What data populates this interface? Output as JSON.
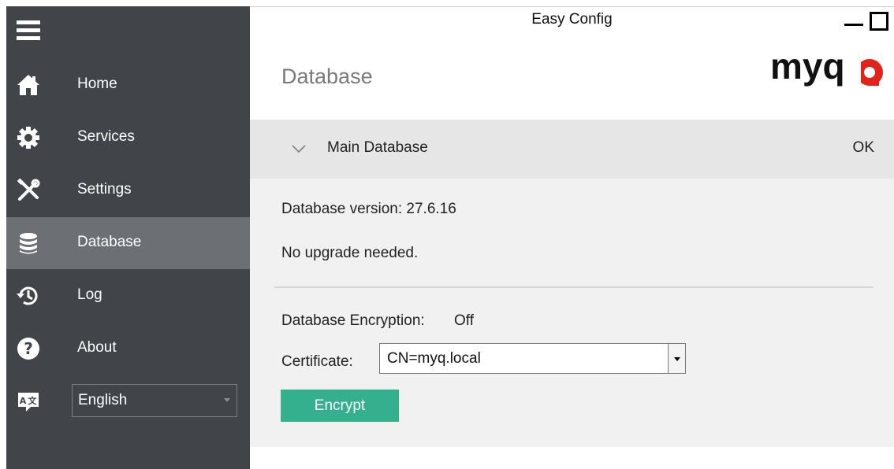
{
  "window": {
    "title": "Easy Config"
  },
  "sidebar": {
    "items": [
      {
        "label": "Home",
        "icon": "home-icon"
      },
      {
        "label": "Services",
        "icon": "gear-icon"
      },
      {
        "label": "Settings",
        "icon": "tools-icon"
      },
      {
        "label": "Database",
        "icon": "database-icon",
        "active": true
      },
      {
        "label": "Log",
        "icon": "history-icon"
      },
      {
        "label": "About",
        "icon": "help-icon"
      }
    ],
    "language": {
      "value": "English",
      "icon": "language-icon"
    }
  },
  "page": {
    "title": "Database",
    "logo_text": "myq"
  },
  "panel": {
    "title": "Main Database",
    "status": "OK",
    "version_line": "Database version: 27.6.16",
    "upgrade_line": "No upgrade needed.",
    "encryption_label": "Database Encryption:",
    "encryption_value": "Off",
    "certificate_label": "Certificate:",
    "certificate_value": "CN=myq.local",
    "encrypt_button": "Encrypt"
  },
  "colors": {
    "sidebar_bg": "#414549",
    "sidebar_active": "#6c7075",
    "accent_green": "#35b08e",
    "logo_red": "#e2231a"
  }
}
